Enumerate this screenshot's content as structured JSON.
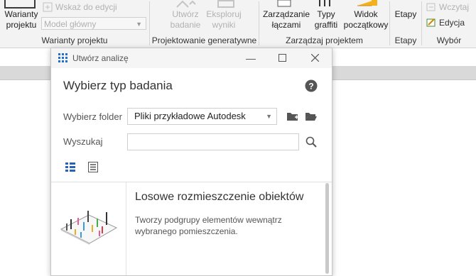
{
  "ribbon": {
    "g1": {
      "variants_label": "Warianty\nprojektu",
      "show_in_edit": "Wskaż do edycji",
      "model_combo": "Model główny",
      "group_label": "Warianty projektu"
    },
    "g2": {
      "create_study": "Utwórz\nbadanie",
      "explore_results": "Eksploruj\nwyniki",
      "group_label": "Projektowanie generatywne"
    },
    "g3": {
      "manage_links": "Zarządzanie\nłączami",
      "graffiti_types": "Typy\ngraffiti",
      "start_view": "Widok\npoczątkowy",
      "group_label": "Zarządzaj projektem"
    },
    "g4": {
      "phases": "Etapy",
      "group_label": "Etapy"
    },
    "g5": {
      "load": "Wczytaj",
      "edit": "Edycja",
      "group_label": "Wybór"
    }
  },
  "dialog": {
    "title": "Utwórz analizę",
    "heading": "Wybierz typ badania",
    "folder_label": "Wybierz folder",
    "folder_value": "Pliki przykładowe Autodesk",
    "search_label": "Wyszukaj",
    "search_value": "",
    "study": {
      "title": "Losowe rozmieszczenie obiektów",
      "description": "Tworzy podgrupy elementów wewnątrz wybranego pomieszczenia."
    }
  },
  "colors": {
    "accent": "#1f6fd1",
    "folder_yellow": "#f3b11d",
    "ribbon_bg": "#f3f3f3"
  }
}
